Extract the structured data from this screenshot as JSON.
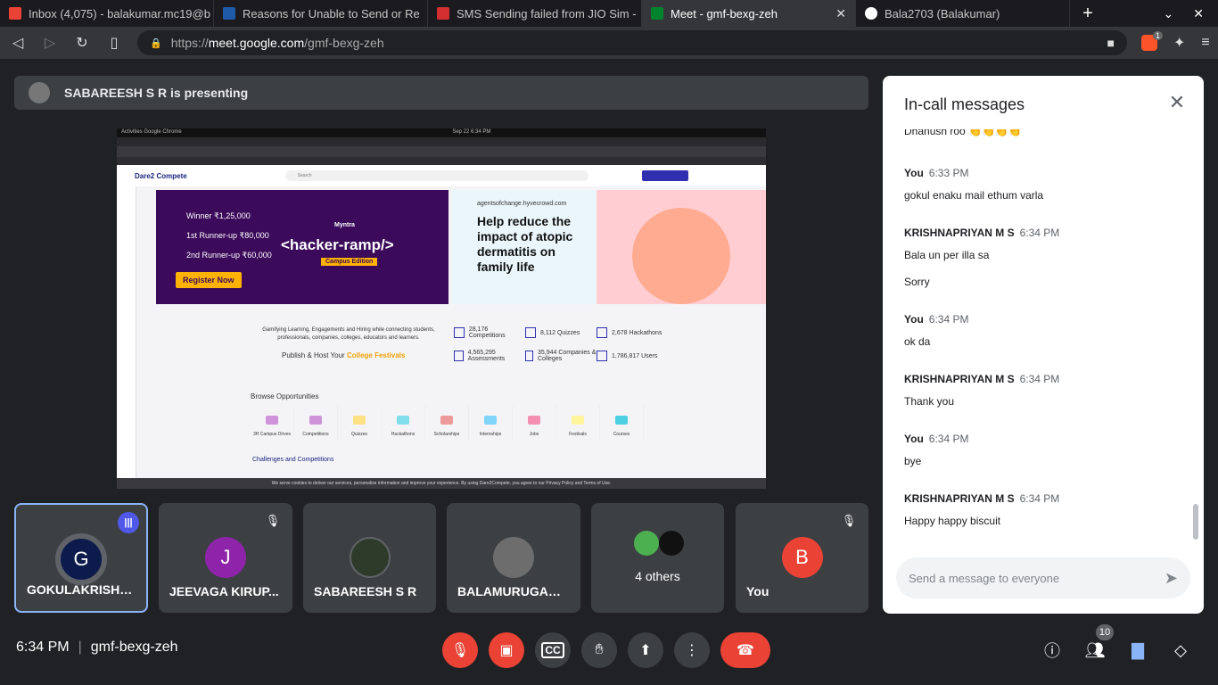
{
  "browser": {
    "tabs": [
      {
        "title": "Inbox (4,075) - balakumar.mc19@b",
        "color": "#ea4335"
      },
      {
        "title": "Reasons for Unable to Send or Re",
        "color": "#1e5aa8"
      },
      {
        "title": "SMS Sending failed from JIO Sim -",
        "color": "#d32f2f"
      },
      {
        "title": "Meet - gmf-bexg-zeh",
        "color": "#00832d",
        "close": "✕"
      },
      {
        "title": "Bala2703 (Balakumar)",
        "color": "#ffffff"
      }
    ],
    "new_tab": "+",
    "url_prefix": "https://",
    "url_host": "meet.google.com",
    "url_path": "/gmf-bexg-zeh",
    "brave_badge": "1"
  },
  "meet": {
    "presenting": "SABAREESH S R is presenting",
    "shared_screen": {
      "top_left": "Activities   Google Chrome",
      "top_center": "Sep 22  6:34 PM",
      "logo": "Dare2 Compete",
      "search": "Search",
      "banner1_title": "<hacker-ramp/>",
      "banner1_brand": "Myntra",
      "banner1_edition": "Campus Edition",
      "banner1_winner": "Winner ₹1,25,000",
      "banner1_runner1": "1st Runner-up ₹80,000",
      "banner1_runner2": "2nd Runner-up ₹60,000",
      "banner1_register": "Register Now",
      "banner2_url": "agentsofchange.hyvecrowd.com",
      "banner2_headline": "Help reduce the impact of atopic dermatitis on family life",
      "tagline": "Gamifying Learning, Engagements and Hiring while connecting students, professionals, companies, colleges, educators and learners.",
      "publish_prefix": "Publish & Host Your",
      "publish_highlight": "College Festivals",
      "stats": [
        "28,176 Competitions",
        "8,112 Quizzes",
        "2,678 Hackathons",
        "4,565,295 Assessments",
        "35,944 Companies & Colleges",
        "1,786,817 Users"
      ],
      "browse": "Browse Opportunities",
      "opportunities": [
        "3H Campus Drives",
        "Competitions",
        "Quizzes",
        "Hackathons",
        "Scholarships",
        "Internships",
        "Jobs",
        "Festivals",
        "Courses"
      ],
      "challenges": "Challenges and Competitions",
      "cookie": "We serve cookies to deliver our services, personalise information and improve your experience. By using Dare2Compete, you agree to our Privacy Policy and Terms of Use."
    },
    "participants": [
      {
        "name": "GOKULAKRISHN...",
        "initial": "G",
        "color": "#0d1b4c"
      },
      {
        "name": "JEEVAGA KIRUP...",
        "initial": "J",
        "color": "#8e24aa"
      },
      {
        "name": "SABAREESH S R",
        "initial": "",
        "color": "#5f6368"
      },
      {
        "name": "BALAMURUGAN R",
        "initial": "",
        "color": "#7a7a7a"
      },
      {
        "name": "4 others",
        "initial": "",
        "color": "#3c4043"
      },
      {
        "name": "You",
        "initial": "B",
        "color": "#ea4335"
      }
    ],
    "time": "6:34 PM",
    "meeting_code": "gmf-bexg-zeh",
    "people_count": "10"
  },
  "chat": {
    "title": "In-call messages",
    "partial_top": "Dhanush roo 👏👏👏👏",
    "messages": [
      {
        "sender": "You",
        "time": "6:33 PM",
        "texts": [
          "gokul enaku mail ethum varla"
        ]
      },
      {
        "sender": "KRISHNAPRIYAN M S",
        "time": "6:34 PM",
        "texts": [
          "Bala un per illa sa",
          "Sorry"
        ]
      },
      {
        "sender": "You",
        "time": "6:34 PM",
        "texts": [
          "ok da"
        ]
      },
      {
        "sender": "KRISHNAPRIYAN M S",
        "time": "6:34 PM",
        "texts": [
          "Thank you"
        ]
      },
      {
        "sender": "You",
        "time": "6:34 PM",
        "texts": [
          "bye"
        ]
      },
      {
        "sender": "KRISHNAPRIYAN M S",
        "time": "6:34 PM",
        "texts": [
          "Happy happy biscuit"
        ]
      }
    ],
    "input_placeholder": "Send a message to everyone"
  }
}
